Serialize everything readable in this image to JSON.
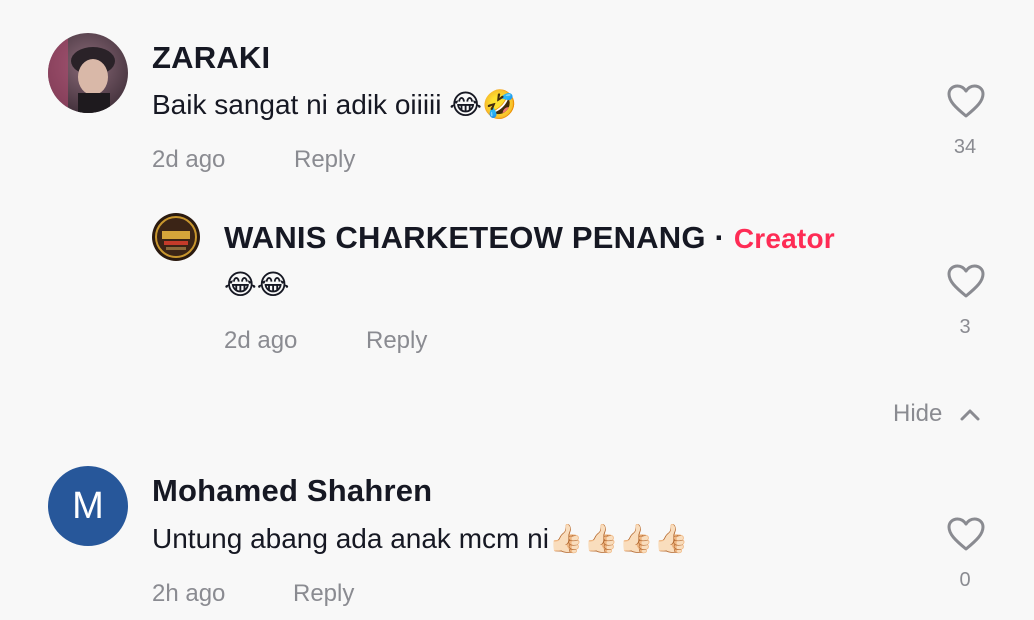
{
  "comments": [
    {
      "username": "ZARAKI",
      "text": "Baik sangat ni adik oiiiii 😂🤣",
      "time": "2d ago",
      "reply_label": "Reply",
      "likes": "34",
      "replies": [
        {
          "username": "WANIS CHARKETEOW PENANG",
          "separator": "·",
          "badge": "Creator",
          "text": "😂😂",
          "time": "2d ago",
          "reply_label": "Reply",
          "likes": "3"
        }
      ]
    },
    {
      "username": "Mohamed Shahren",
      "avatar_letter": "M",
      "text": "Untung abang ada anak mcm ni👍🏻👍🏻👍🏻👍🏻",
      "time": "2h ago",
      "reply_label": "Reply",
      "likes": "0"
    }
  ],
  "hide_label": "Hide",
  "colors": {
    "background": "#f8f8f8",
    "creator_badge": "#fe2c55",
    "secondary_text": "#8a8b91",
    "avatar_letter_bg": "#27579a"
  },
  "icons": {
    "like": "heart-outline-icon",
    "hide": "chevron-up-icon"
  }
}
